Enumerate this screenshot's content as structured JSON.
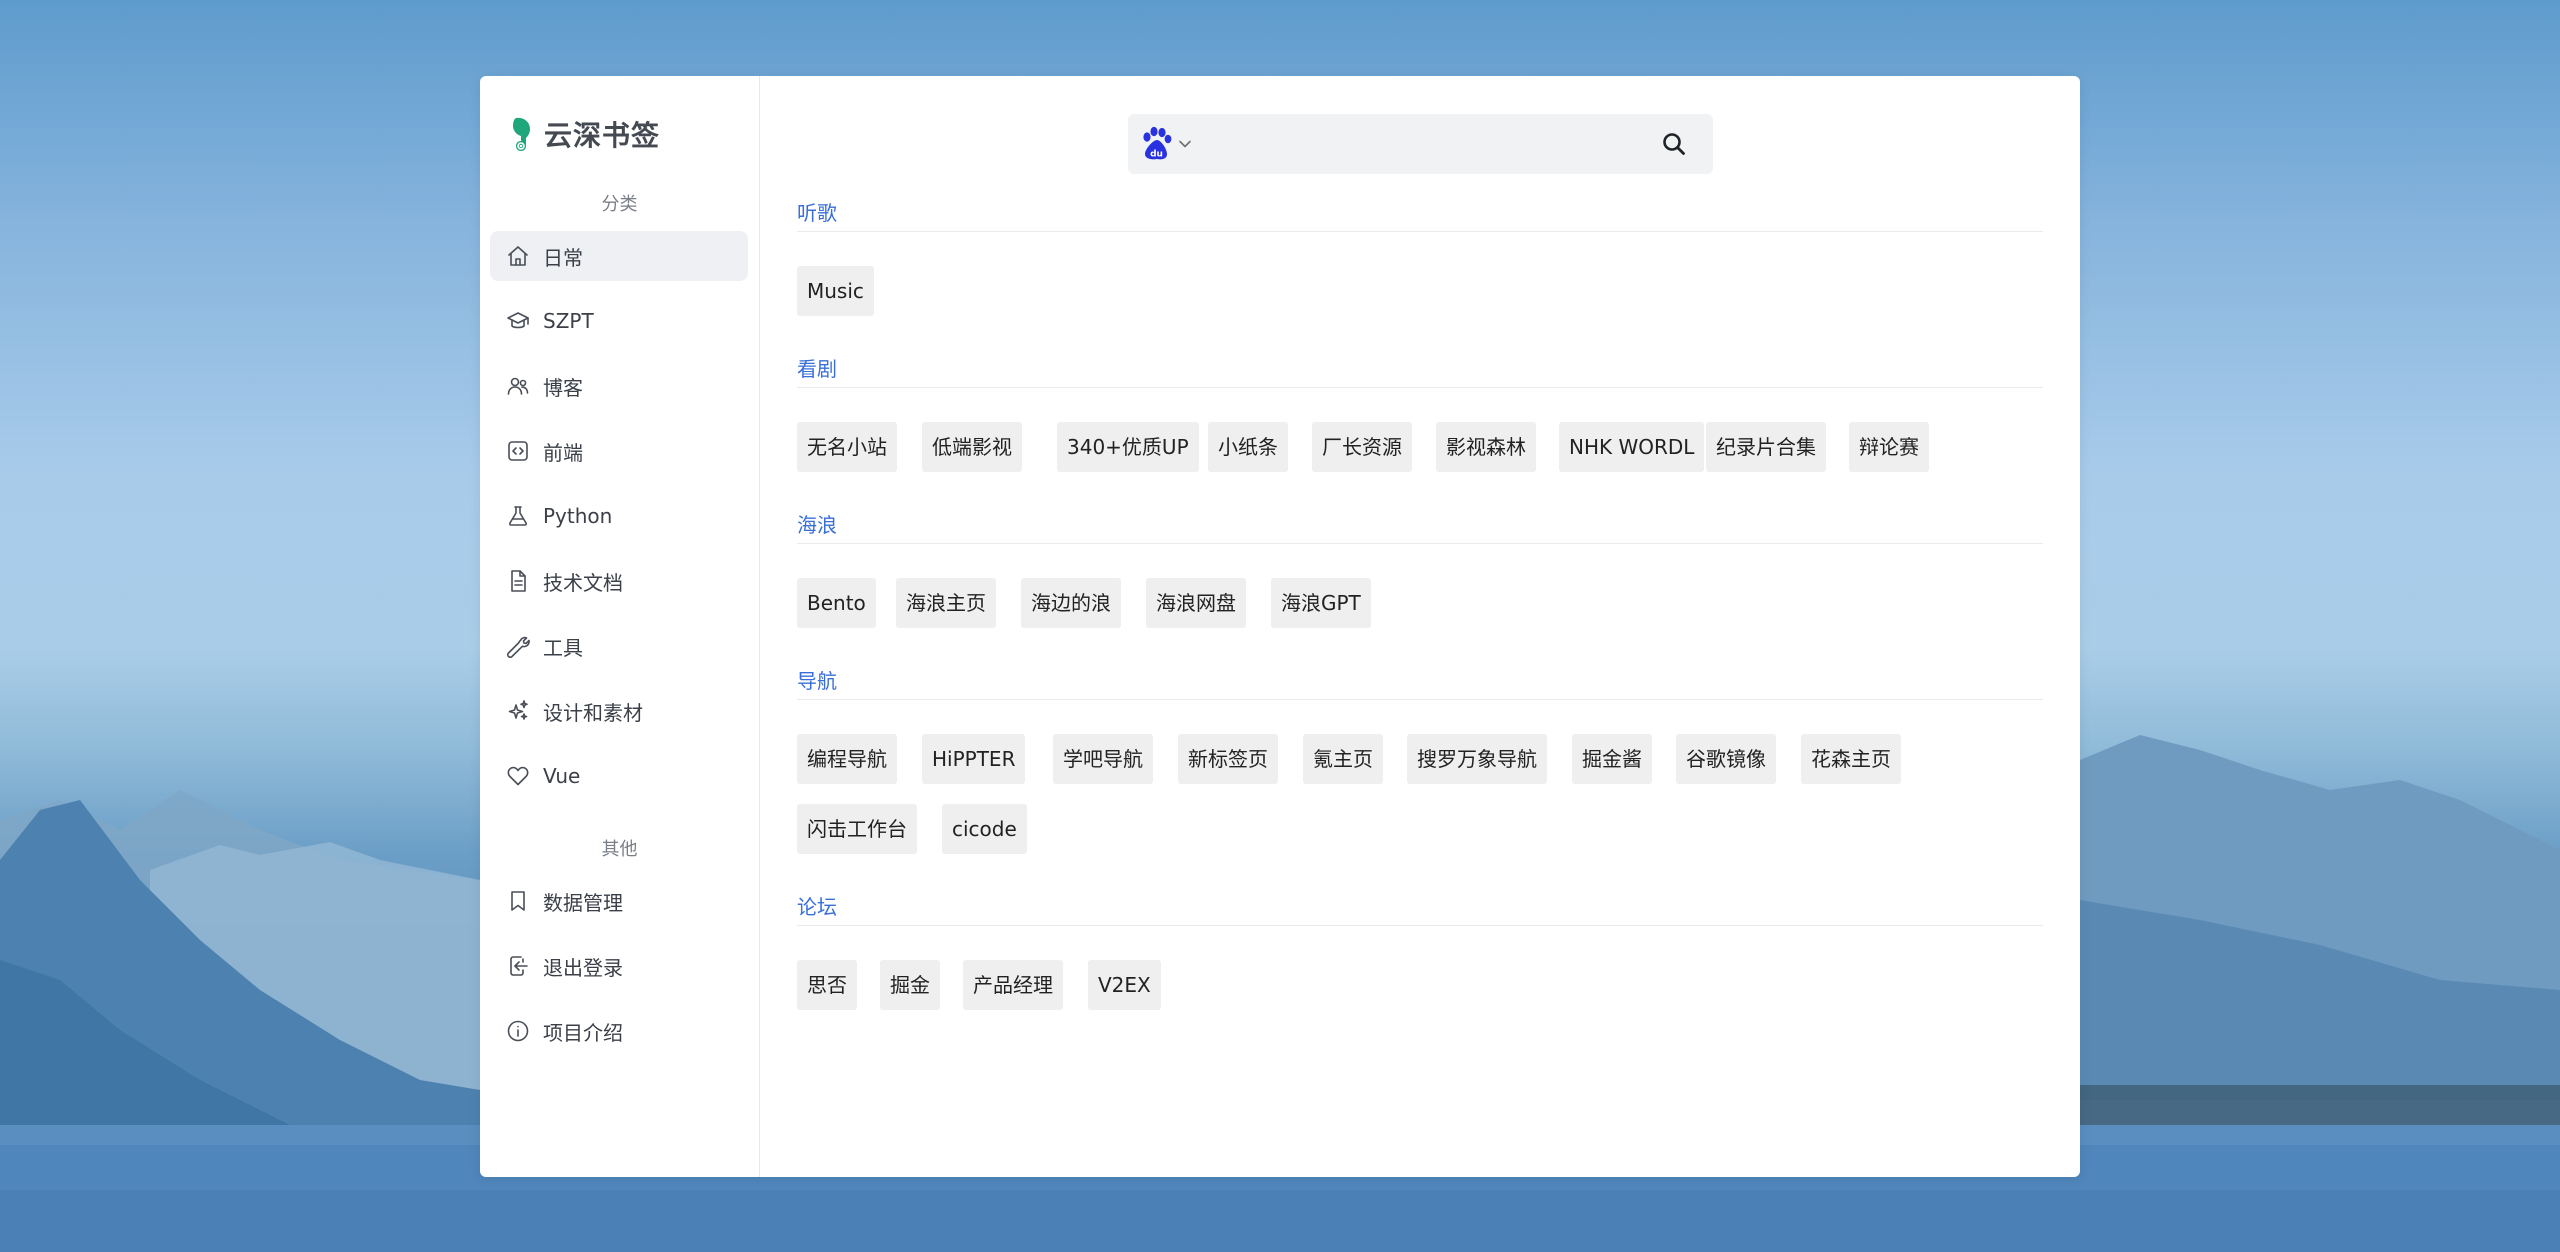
{
  "brand": {
    "name": "云深书签"
  },
  "sidebar": {
    "section_categories": "分类",
    "section_other": "其他",
    "items": [
      {
        "label": "日常",
        "icon": "home-icon",
        "active": true
      },
      {
        "label": "SZPT",
        "icon": "graduation-cap-icon"
      },
      {
        "label": "博客",
        "icon": "users-icon"
      },
      {
        "label": "前端",
        "icon": "code-icon"
      },
      {
        "label": "Python",
        "icon": "flask-icon"
      },
      {
        "label": "技术文档",
        "icon": "document-icon"
      },
      {
        "label": "工具",
        "icon": "wrench-icon"
      },
      {
        "label": "设计和素材",
        "icon": "sparkles-icon"
      },
      {
        "label": "Vue",
        "icon": "heart-icon"
      }
    ],
    "other_items": [
      {
        "label": "数据管理",
        "icon": "bookmark-icon"
      },
      {
        "label": "退出登录",
        "icon": "logout-icon"
      },
      {
        "label": "项目介绍",
        "icon": "info-icon"
      }
    ]
  },
  "search": {
    "engine": "baidu",
    "engine_icon": "baidu-paw-icon",
    "placeholder": "",
    "value": ""
  },
  "groups": [
    {
      "title": "听歌",
      "links": [
        "Music"
      ]
    },
    {
      "title": "看剧",
      "links": [
        "无名小站",
        "低端影视",
        "340+优质UP",
        "小纸条",
        "厂长资源",
        "影视森林",
        "NHK WORDL",
        "纪录片合集",
        "辩论赛"
      ]
    },
    {
      "title": "海浪",
      "links": [
        "Bento",
        "海浪主页",
        "海边的浪",
        "海浪网盘",
        "海浪GPT"
      ]
    },
    {
      "title": "导航",
      "links": [
        "编程导航",
        "HiPPTER",
        "学吧导航",
        "新标签页",
        "氪主页",
        "搜罗万象导航",
        "掘金酱",
        "谷歌镜像",
        "花森主页",
        "闪击工作台",
        "cicode"
      ]
    },
    {
      "title": "论坛",
      "links": [
        "思否",
        "掘金",
        "产品经理",
        "V2EX"
      ]
    }
  ],
  "colors": {
    "accent": "#3a6fd8",
    "brand_green": "#1fa67a",
    "baidu_blue": "#2932e1"
  }
}
